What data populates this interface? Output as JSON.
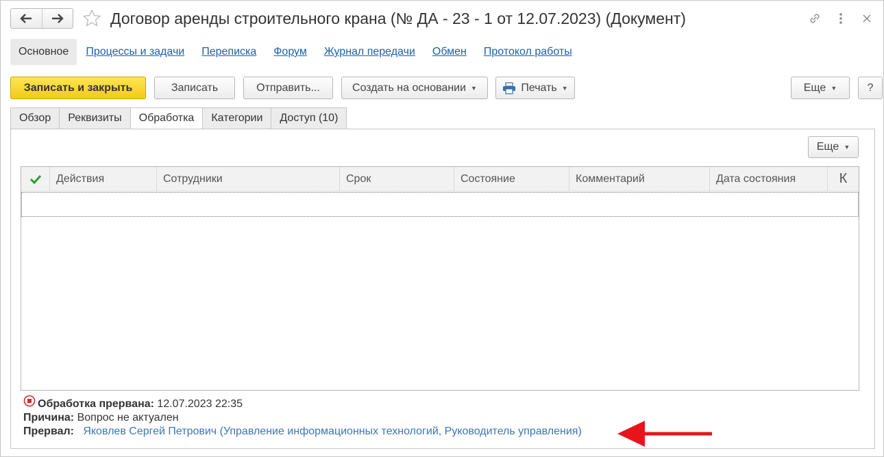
{
  "window": {
    "title": "Договор аренды строительного крана (№ ДА - 23 - 1 от 12.07.2023) (Документ)",
    "icons": [
      "back-arrow-icon",
      "forward-arrow-icon",
      "star-icon",
      "link-icon",
      "more-vertical-icon",
      "close-icon"
    ]
  },
  "secnav": {
    "active": "Основное",
    "links": [
      "Процессы и задачи",
      "Переписка",
      "Форум",
      "Журнал передачи",
      "Обмен",
      "Протокол работы"
    ]
  },
  "toolbar": {
    "save_close": "Записать и закрыть",
    "save": "Записать",
    "send": "Отправить...",
    "create_based": "Создать на основании",
    "print": "Печать",
    "more": "Еще",
    "help": "?"
  },
  "tabs": [
    "Обзор",
    "Реквизиты",
    "Обработка",
    "Категории",
    "Доступ (10)"
  ],
  "active_tab": "Обработка",
  "panel": {
    "more": "Еще",
    "table": {
      "columns": [
        "Действия",
        "Сотрудники",
        "Срок",
        "Состояние",
        "Комментарий",
        "Дата состояния"
      ],
      "last_column": "К",
      "rows": []
    }
  },
  "status": {
    "stopped_label": "Обработка прервана:",
    "stopped_value": "12.07.2023 22:35",
    "reason_label": "Причина:",
    "reason_value": "Вопрос не актуален",
    "by_label": "Прервал:",
    "by_value": "Яковлев Сергей Петрович (Управление информационных технологий, Руководитель управления)"
  },
  "colors": {
    "accent_yellow": "#f2cb19",
    "link_blue": "#1f5fa8",
    "status_red": "#d42a2a",
    "check_green": "#2a9d2a"
  }
}
